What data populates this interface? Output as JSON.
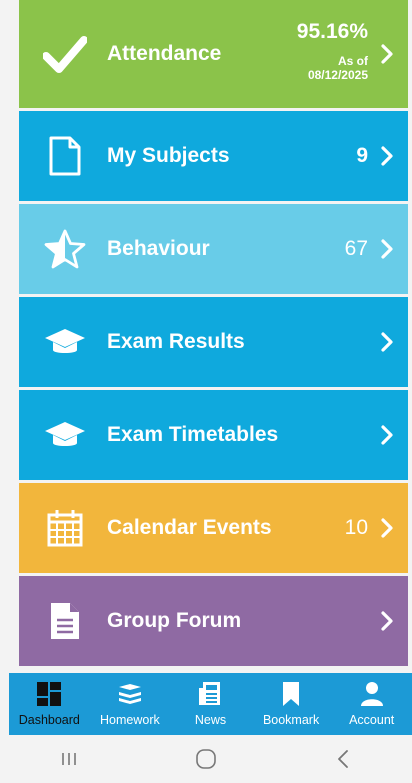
{
  "tiles": [
    {
      "id": "attendance",
      "label": "Attendance",
      "percent": "95.16%",
      "as_of_label": "As of",
      "as_of_date": "08/12/2025",
      "color": "#8bc34a",
      "icon": "checkmark-icon"
    },
    {
      "id": "subjects",
      "label": "My Subjects",
      "count": "9",
      "color": "#0fa9dd",
      "icon": "document-icon"
    },
    {
      "id": "behaviour",
      "label": "Behaviour",
      "count": "67",
      "color": "#68cce8",
      "icon": "star-half-icon"
    },
    {
      "id": "exam_results",
      "label": "Exam Results",
      "color": "#0fa9dd",
      "icon": "graduation-cap-icon"
    },
    {
      "id": "exam_timetables",
      "label": "Exam Timetables",
      "color": "#0fa9dd",
      "icon": "graduation-cap-icon"
    },
    {
      "id": "calendar",
      "label": "Calendar Events",
      "count": "10",
      "color": "#f2b63c",
      "icon": "calendar-icon"
    },
    {
      "id": "forum",
      "label": "Group Forum",
      "color": "#8f6aa3",
      "icon": "file-text-icon"
    }
  ],
  "nav": [
    {
      "label": "Dashboard",
      "icon": "dashboard-grid-icon",
      "active": true
    },
    {
      "label": "Homework",
      "icon": "books-icon",
      "active": false
    },
    {
      "label": "News",
      "icon": "newspaper-icon",
      "active": false
    },
    {
      "label": "Bookmark",
      "icon": "bookmark-icon",
      "active": false
    },
    {
      "label": "Account",
      "icon": "user-icon",
      "active": false
    }
  ],
  "colors": {
    "nav_bg": "#1c9ad6",
    "page_bg": "#f3f3f3",
    "active_icon": "#111111"
  }
}
